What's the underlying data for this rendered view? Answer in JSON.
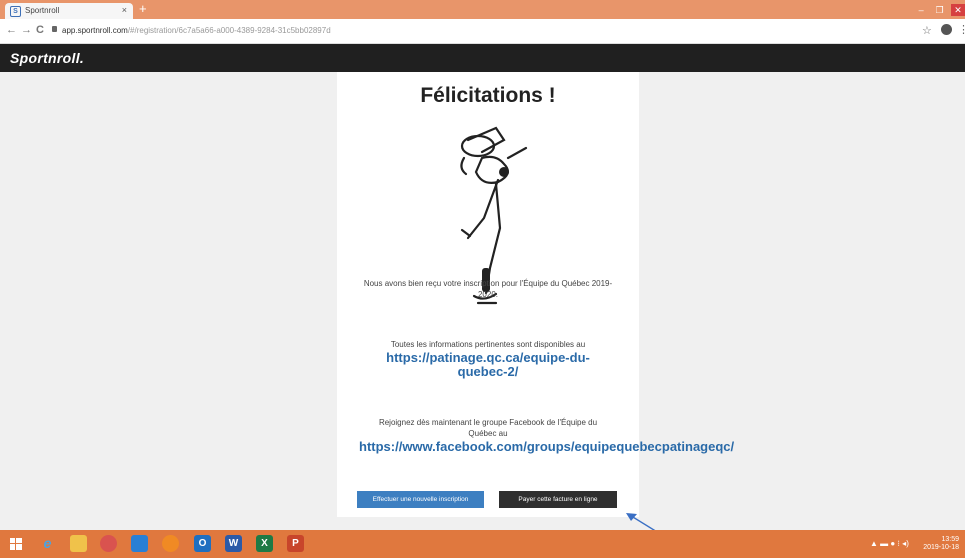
{
  "browser": {
    "tab_title": "Sportnroll",
    "tab_favicon": "S",
    "close_tab": "×",
    "new_tab": "+",
    "url_host": "app.sportnroll.com",
    "url_path": "/#/registration/6c7a5a66-a000-4389-9284-31c5bb02897d",
    "back": "←",
    "forward": "→",
    "reload": "C",
    "bookmark": "☆",
    "menu": "⋮",
    "min": "–",
    "max": "❐",
    "close": "✕"
  },
  "header": {
    "logo": "Sportnroll."
  },
  "main": {
    "title": "Félicitations !",
    "registration_msg": "Nous avons bien reçu votre inscription pour l'Équipe du Québec 2019-2020.",
    "info_msg": "Toutes les informations pertinentes sont disponibles au",
    "info_link": "https://patinage.qc.ca/equipe-du-quebec-2/",
    "facebook_msg": "Rejoignez dès maintenant le groupe Facebook de l'Équipe du Québec au",
    "facebook_link": "https://www.facebook.com/groups/equipequebecpatinageqc/",
    "new_registration_button": "Effectuer une nouvelle inscription",
    "pay_button": "Payer cette facture en ligne"
  },
  "taskbar": {
    "time": "13:59",
    "date": "2019-10-18",
    "tray_icons": "▲ ▬ ● ⁝ ◂)"
  },
  "colors": {
    "tab_bar": "#e8956a",
    "taskbar": "#e0783e",
    "header": "#202020",
    "link": "#2a6aa8",
    "primary_button": "#3d7fc1",
    "dark_button": "#2f2f2f"
  }
}
